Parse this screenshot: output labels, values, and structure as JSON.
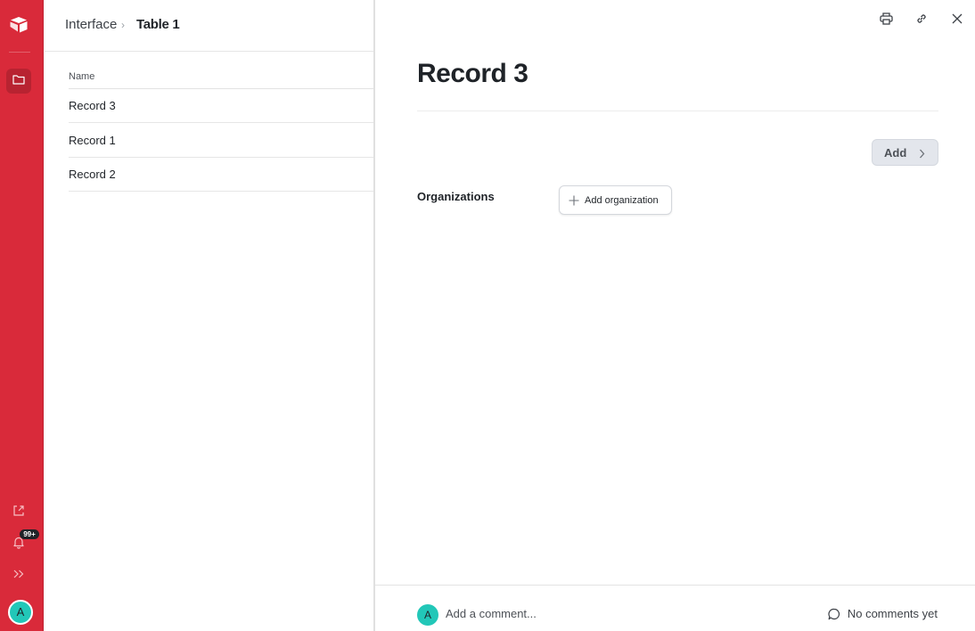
{
  "sidebar": {
    "notifications_badge": "99+",
    "avatar_initial": "A",
    "icons": [
      "airtable-logo-icon",
      "folder-icon",
      "share-icon",
      "bell-icon",
      "double-chevron-right-icon"
    ]
  },
  "breadcrumb": {
    "parent": "Interface",
    "separator": "›",
    "current": "Table 1"
  },
  "table": {
    "column_header": "Name",
    "rows": [
      "Record 3",
      "Record 1",
      "Record 2"
    ]
  },
  "detail": {
    "title": "Record 3",
    "add_button_label": "Add",
    "field_label": "Organizations",
    "add_organization_label": "Add organization",
    "toolbar_icons": [
      "print-icon",
      "link-icon",
      "close-icon"
    ]
  },
  "comments": {
    "avatar_initial": "A",
    "placeholder": "Add a comment...",
    "status": "No comments yet"
  },
  "colors": {
    "rail": "#d92a3a",
    "avatar": "#22c7b8"
  }
}
